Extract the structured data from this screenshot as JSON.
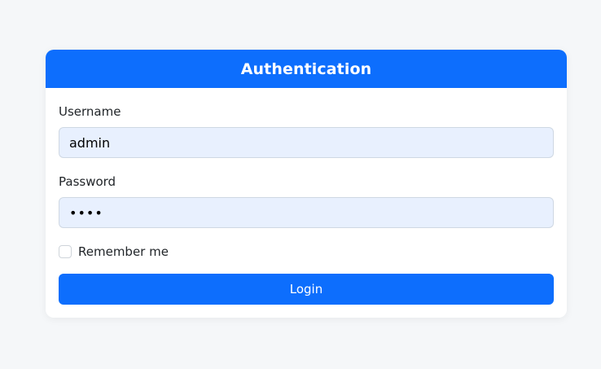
{
  "header": {
    "title": "Authentication"
  },
  "form": {
    "username_label": "Username",
    "username_value": "admin",
    "password_label": "Password",
    "password_value": "admi",
    "remember_label": "Remember me",
    "remember_checked": false,
    "login_label": "Login"
  },
  "colors": {
    "accent": "#0d6efd",
    "input_background": "#e8f0fe",
    "page_background": "#f5f7f9"
  }
}
